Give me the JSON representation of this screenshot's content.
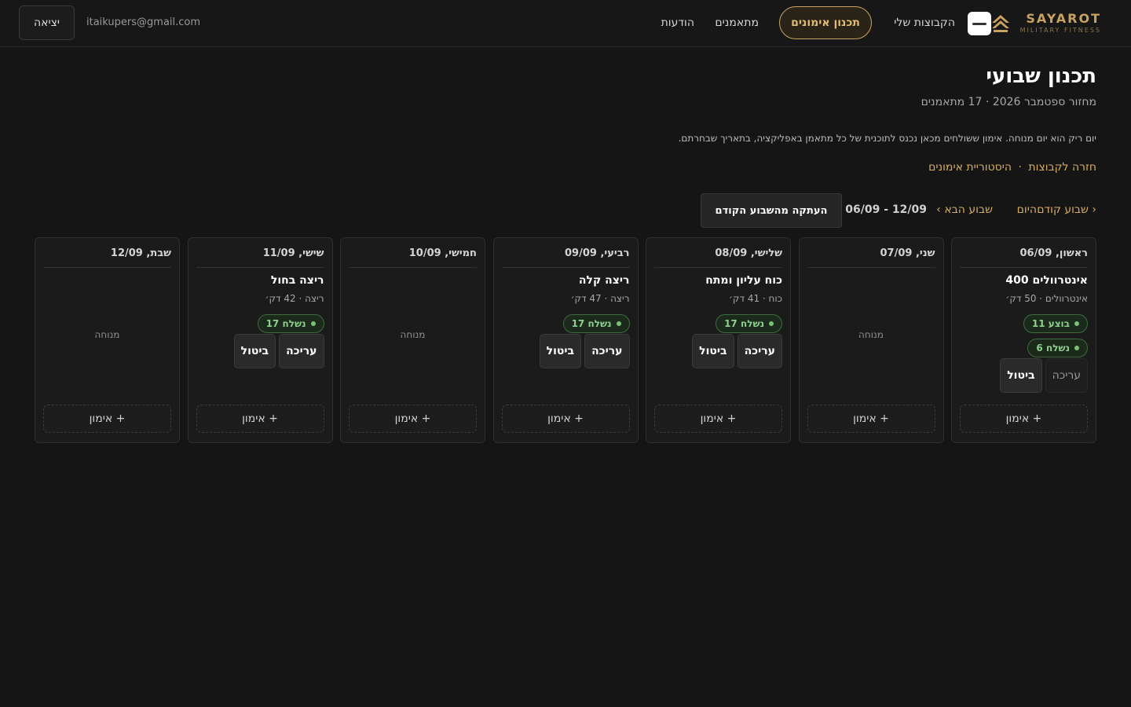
{
  "header": {
    "brand_name": "SAYAROT",
    "brand_sub": "MILITARY FITNESS",
    "nav": {
      "groups": "הקבוצות שלי",
      "plan": "תכנון אימונים",
      "trainees": "מתאמנים",
      "messages": "הודעות"
    },
    "user_email": "itaikupers@gmail.com",
    "logout": "יציאה"
  },
  "page": {
    "title": "תכנון שבועי",
    "subtitle": "מחזור ספטמבר 2026 · 17 מתאמנים",
    "info": "יום ריק הוא יום מנוחה. אימון ששולחים מכאן נכנס לתוכנית של כל מתאמן באפליקציה, בתאריך שבחרתם.",
    "link_back": "חזרה לקבוצות",
    "link_sep": "·",
    "link_history": "היסטוריית אימונים"
  },
  "week_nav": {
    "prev": "‹ שבוע קודם",
    "today": "היום",
    "next": "שבוע הבא ›",
    "range": "06/09 - 12/09",
    "copy": "העתקה מהשבוע הקודם"
  },
  "days": [
    {
      "name": "ראשון, 06/09",
      "workout_title": "אינטרוולים 400",
      "workout_meta": "אינטרוולים · 50 דק׳",
      "badges": [
        "בוצע 11",
        "נשלח 6"
      ],
      "edit": "עריכה",
      "cancel": "ביטול",
      "add": "+ אימון"
    },
    {
      "name": "שני, 07/09",
      "rest": "מנוחה",
      "add": "+ אימון"
    },
    {
      "name": "שלישי, 08/09",
      "workout_title": "כוח עליון ומתח",
      "workout_meta": "כוח · 41 דק׳",
      "badges": [
        "נשלח 17"
      ],
      "edit": "עריכה",
      "cancel": "ביטול",
      "add": "+ אימון"
    },
    {
      "name": "רביעי, 09/09",
      "workout_title": "ריצה קלה",
      "workout_meta": "ריצה · 47 דק׳",
      "badges": [
        "נשלח 17"
      ],
      "edit": "עריכה",
      "cancel": "ביטול",
      "add": "+ אימון"
    },
    {
      "name": "חמישי, 10/09",
      "rest": "מנוחה",
      "add": "+ אימון"
    },
    {
      "name": "שישי, 11/09",
      "workout_title": "ריצה בחול",
      "workout_meta": "ריצה · 42 דק׳",
      "badges": [
        "נשלח 17"
      ],
      "edit": "עריכה",
      "cancel": "ביטול",
      "add": "+ אימון"
    },
    {
      "name": "שבת, 12/09",
      "rest": "מנוחה",
      "add": "+ אימון"
    }
  ],
  "colors": {
    "accent": "#c9a35e",
    "background": "#151515",
    "status_green": "#8fd08f"
  }
}
